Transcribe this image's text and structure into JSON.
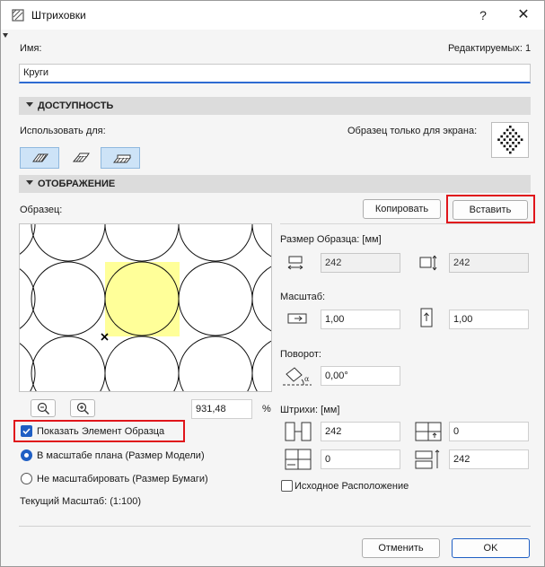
{
  "window": {
    "title": "Штриховки",
    "help": "?",
    "close": "✕"
  },
  "name_row": {
    "label": "Имя:",
    "editable_count": "Редактируемых: 1",
    "value": "Круги"
  },
  "availability": {
    "header": "ДОСТУПНОСТЬ",
    "use_for": "Использовать для:",
    "screen_only": "Образец только для экрана:"
  },
  "display": {
    "header": "ОТОБРАЖЕНИЕ",
    "sample_label": "Образец:",
    "copy_button": "Копировать",
    "paste_button": "Вставить",
    "zoom_value": "931,48",
    "zoom_unit": "%",
    "show_sample": "Показать Элемент Образца",
    "radio_model": "В масштабе плана (Размер Модели)",
    "radio_paper": "Не масштабировать (Размер Бумаги)",
    "current_scale": "Текущий Масштаб: (1:100)"
  },
  "size": {
    "label": "Размер Образца: [мм]",
    "width": "242",
    "height": "242"
  },
  "scale": {
    "label": "Масштаб:",
    "x": "1,00",
    "y": "1,00"
  },
  "rotation": {
    "label": "Поворот:",
    "value": "0,00°"
  },
  "hatches": {
    "label": "Штрихи: [мм]",
    "a": "242",
    "b": "0",
    "c": "0",
    "d": "242"
  },
  "origin": {
    "label": "Исходное Расположение"
  },
  "footer": {
    "cancel": "Отменить",
    "ok": "OK"
  },
  "colors": {
    "accent": "#1f5fc4",
    "highlight": "#e0151b",
    "sample_fill": "#ffff99"
  }
}
